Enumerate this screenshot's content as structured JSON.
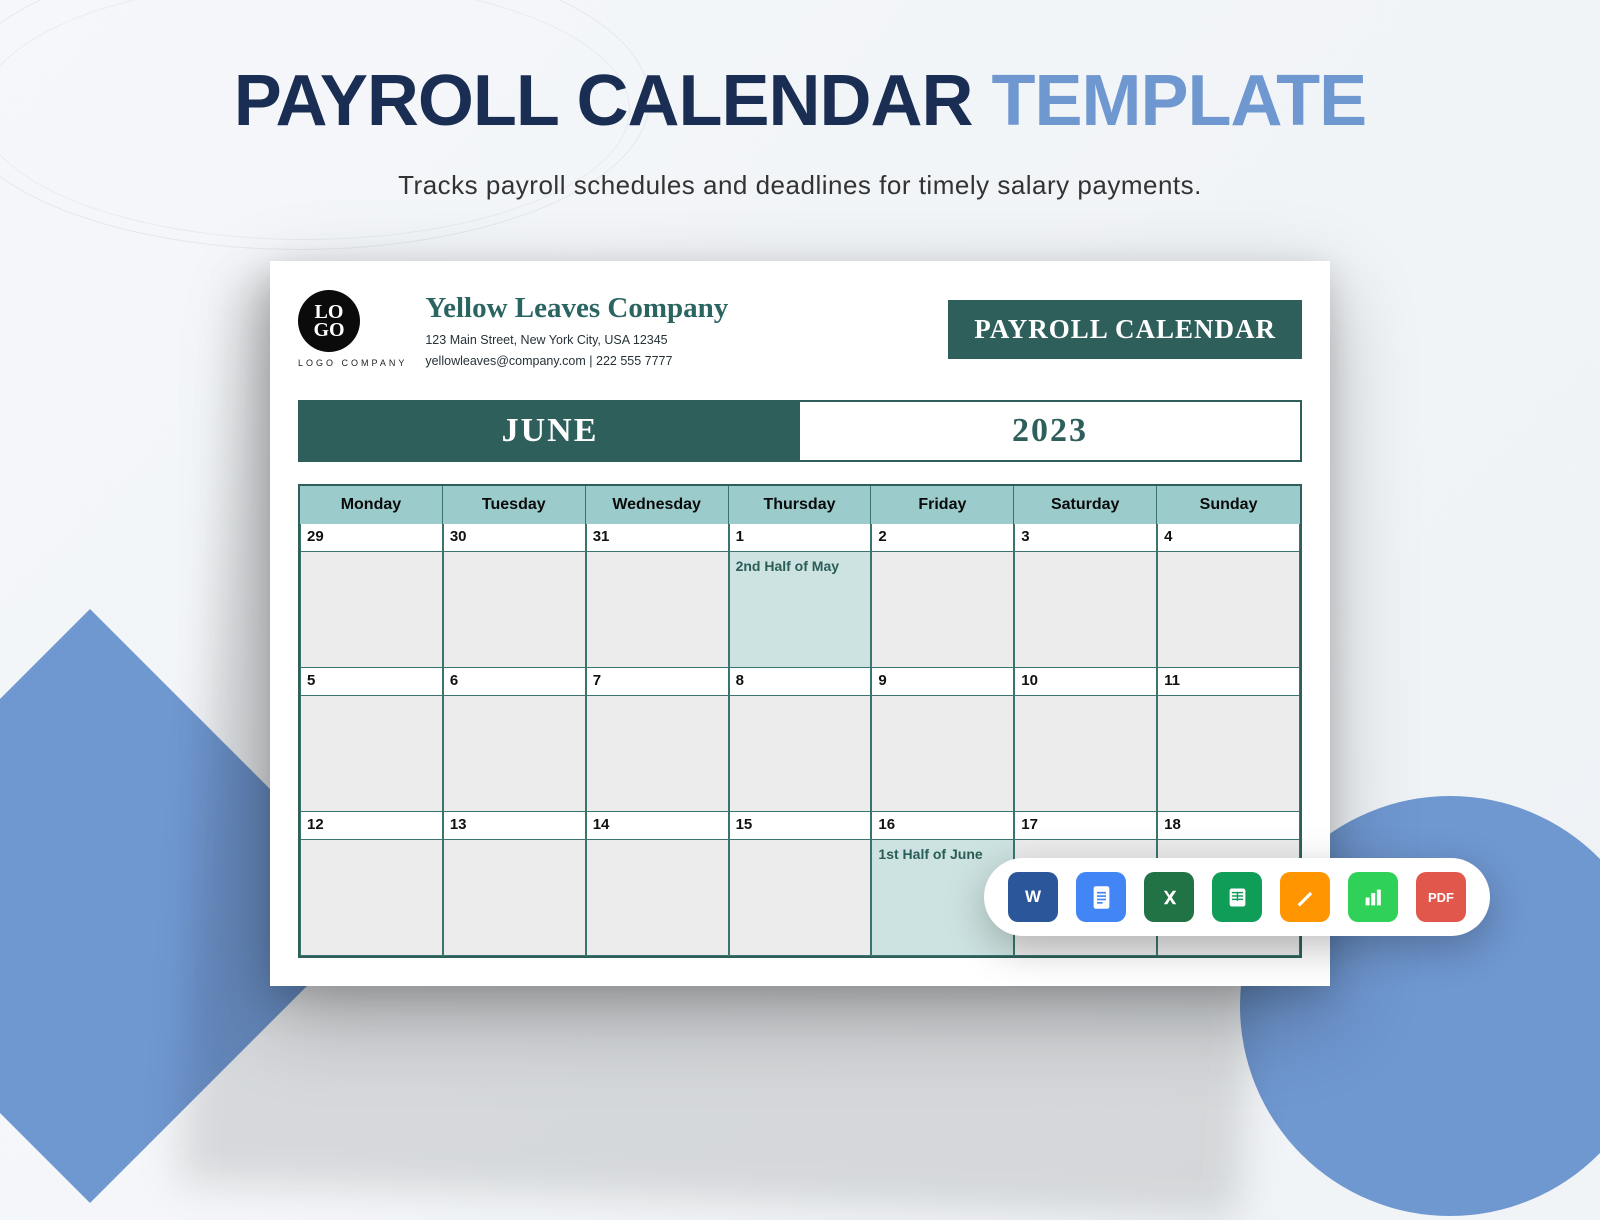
{
  "header": {
    "title_main": "PAYROLL CALENDAR",
    "title_accent": "TEMPLATE",
    "subtitle": "Tracks payroll schedules and deadlines for timely salary payments."
  },
  "document": {
    "logo_line1": "LO",
    "logo_line2": "GO",
    "logo_caption": "LOGO COMPANY",
    "company_name": "Yellow Leaves Company",
    "company_address": "123 Main Street, New York City, USA 12345",
    "company_contact": "yellowleaves@company.com | 222 555 7777",
    "tag": "PAYROLL CALENDAR",
    "month": "JUNE",
    "year": "2023",
    "weekdays": [
      "Monday",
      "Tuesday",
      "Wednesday",
      "Thursday",
      "Friday",
      "Saturday",
      "Sunday"
    ],
    "rows": [
      {
        "nums": [
          "29",
          "30",
          "31",
          "1",
          "2",
          "3",
          "4"
        ],
        "notes": [
          "",
          "",
          "",
          "2nd Half of May",
          "",
          "",
          ""
        ],
        "highlight": [
          false,
          false,
          false,
          true,
          false,
          false,
          false
        ]
      },
      {
        "nums": [
          "5",
          "6",
          "7",
          "8",
          "9",
          "10",
          "11"
        ],
        "notes": [
          "",
          "",
          "",
          "",
          "",
          "",
          ""
        ],
        "highlight": [
          false,
          false,
          false,
          false,
          false,
          false,
          false
        ]
      },
      {
        "nums": [
          "12",
          "13",
          "14",
          "15",
          "16",
          "17",
          "18"
        ],
        "notes": [
          "",
          "",
          "",
          "",
          "1st Half of June",
          "",
          ""
        ],
        "highlight": [
          false,
          false,
          false,
          false,
          true,
          false,
          false
        ]
      }
    ]
  },
  "formats": {
    "word": "W",
    "pdf": "PDF"
  }
}
